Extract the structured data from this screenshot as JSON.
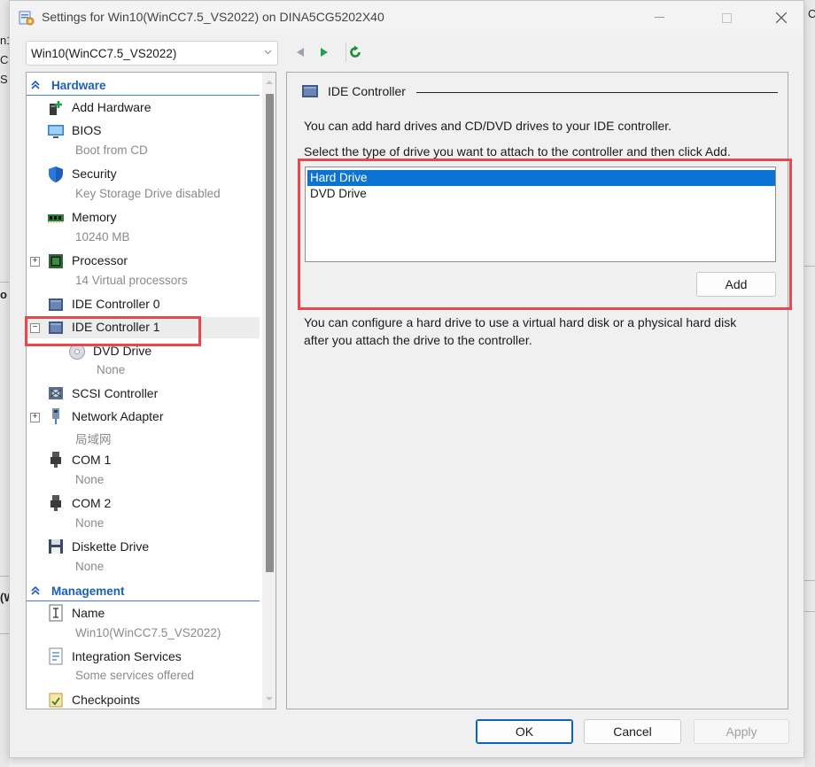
{
  "background": {
    "left_fragments": [
      "n1",
      "C",
      "S",
      "o",
      "(W"
    ],
    "right_fragment": "C"
  },
  "window": {
    "title": "Settings for Win10(WinCC7.5_VS2022) on DINA5CG5202X40"
  },
  "toolbar": {
    "vm_selector_value": "Win10(WinCC7.5_VS2022)"
  },
  "tree": {
    "hardware_header": "Hardware",
    "management_header": "Management",
    "items": [
      {
        "label": "Add Hardware",
        "sub": ""
      },
      {
        "label": "BIOS",
        "sub": "Boot from CD"
      },
      {
        "label": "Security",
        "sub": "Key Storage Drive disabled"
      },
      {
        "label": "Memory",
        "sub": "10240 MB"
      },
      {
        "label": "Processor",
        "sub": "14 Virtual processors"
      },
      {
        "label": "IDE Controller 0",
        "sub": ""
      },
      {
        "label": "IDE Controller 1",
        "sub": ""
      },
      {
        "label": "DVD Drive",
        "sub": "None"
      },
      {
        "label": "SCSI Controller",
        "sub": ""
      },
      {
        "label": "Network Adapter",
        "sub": "局域网"
      },
      {
        "label": "COM 1",
        "sub": "None"
      },
      {
        "label": "COM 2",
        "sub": "None"
      },
      {
        "label": "Diskette Drive",
        "sub": "None"
      }
    ],
    "management_items": [
      {
        "label": "Name",
        "sub": "Win10(WinCC7.5_VS2022)"
      },
      {
        "label": "Integration Services",
        "sub": "Some services offered"
      },
      {
        "label": "Checkpoints",
        "sub": ""
      }
    ]
  },
  "panel": {
    "title": "IDE Controller",
    "intro": "You can add hard drives and CD/DVD drives to your IDE controller.",
    "instruction": "Select the type of drive you want to attach to the controller and then click Add.",
    "drive_types": [
      "Hard Drive",
      "DVD Drive"
    ],
    "selected_drive": "Hard Drive",
    "add_button": "Add",
    "note_line1": "You can configure a hard drive to use a virtual hard disk or a physical hard disk",
    "note_line2": "after you attach the drive to the controller."
  },
  "footer": {
    "ok": "OK",
    "cancel": "Cancel",
    "apply": "Apply"
  },
  "colors": {
    "accent": "#0a73d3",
    "section_header": "#1b5fb6",
    "highlight_box": "#e8474d",
    "play_green": "#1aa34a"
  }
}
